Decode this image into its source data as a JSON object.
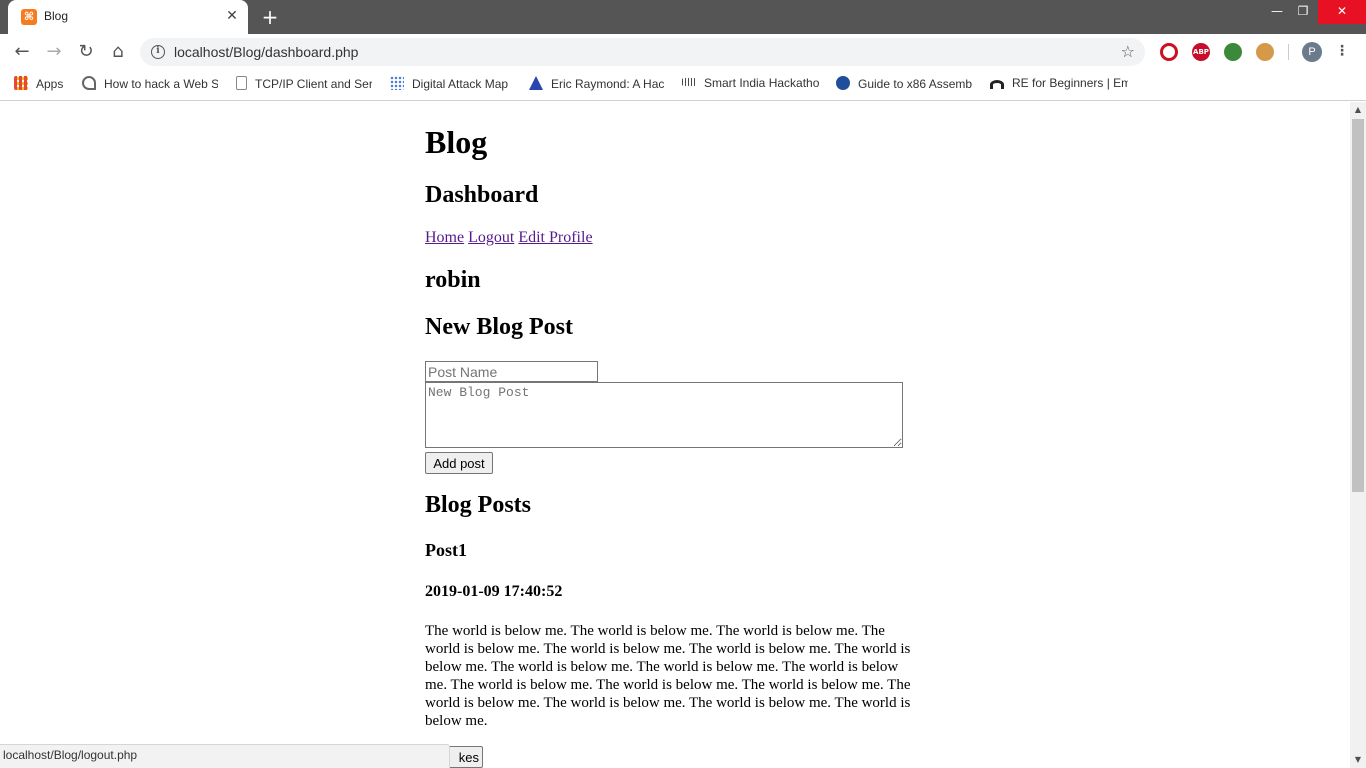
{
  "browser": {
    "tab_title": "Blog",
    "tab_close": "✕",
    "new_tab": "+",
    "url": "localhost/Blog/dashboard.php",
    "window_controls": {
      "minimize": "—",
      "maximize": "❐",
      "close": "✕"
    },
    "profile_initial": "P",
    "extensions": {
      "opera": "",
      "abp": "ABP",
      "globe": "",
      "cookie": ""
    }
  },
  "bookmarks": [
    {
      "label": "Apps",
      "icon": "apps-grid-icon",
      "color": "#e8453c"
    },
    {
      "label": "How to hack a Web S",
      "icon": "hack-site-icon",
      "color": "#666666"
    },
    {
      "label": "TCP/IP Client and Ser",
      "icon": "document-icon",
      "color": "#888888"
    },
    {
      "label": "Digital Attack Map",
      "icon": "dot-grid-icon",
      "color": "#4a7bd0"
    },
    {
      "label": "Eric Raymond: A Hacl",
      "icon": "triangle-logo-icon",
      "color": "#2a44b0"
    },
    {
      "label": "Smart India Hackatho",
      "icon": "cisco-icon",
      "color": "#4a4a4a"
    },
    {
      "label": "Guide to x86 Assemb",
      "icon": "university-icon",
      "color": "#1f4f9a"
    },
    {
      "label": "RE for Beginners | Em",
      "icon": "re-logo-icon",
      "color": "#222222"
    }
  ],
  "page": {
    "site_title": "Blog",
    "dashboard_heading": "Dashboard",
    "nav": {
      "home": "Home",
      "logout": "Logout",
      "edit_profile": "Edit Profile"
    },
    "username": "robin",
    "new_post_heading": "New Blog Post",
    "form": {
      "post_name_placeholder": "Post Name",
      "post_body_placeholder": "New Blog Post",
      "submit_label": "Add post"
    },
    "posts_heading": "Blog Posts",
    "posts": [
      {
        "title": "Post1",
        "timestamp": "2019-01-09 17:40:52",
        "body": "The world is below me. The world is below me. The world is below me. The world is below me. The world is below me. The world is below me. The world is below me. The world is below me. The world is below me. The world is below me. The world is below me. The world is below me. The world is below me. The world is below me. The world is below me. The world is below me. The world is below me.",
        "likes_label": "kes"
      }
    ]
  },
  "status_bar": {
    "hover_url": "localhost/Blog/logout.php"
  },
  "colors": {
    "titlebar": "#555555",
    "link_visited": "#551a8b",
    "close_red": "#e81123"
  }
}
